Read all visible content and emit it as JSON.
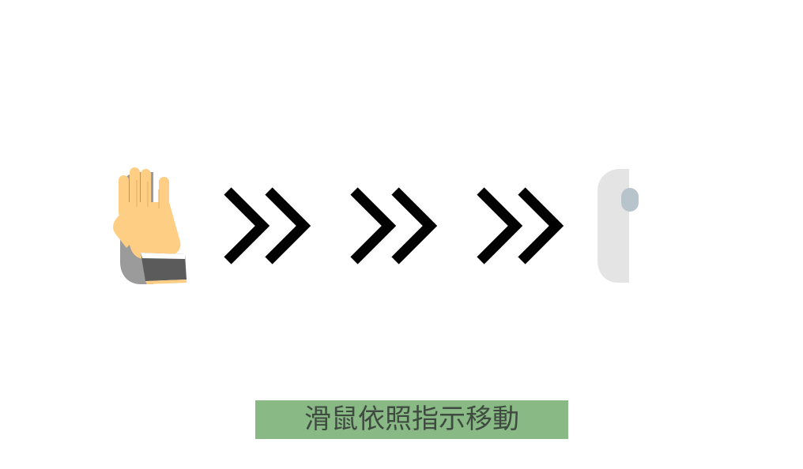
{
  "instruction": {
    "text": "滑鼠依照指示移動"
  },
  "icons": {
    "hand": "hand-on-mouse-icon",
    "arrows": [
      "double-chevron-right-icon",
      "double-chevron-right-icon",
      "double-chevron-right-icon"
    ],
    "target": "mouse-icon"
  },
  "colors": {
    "banner_bg": "#89b985",
    "banner_text": "#3f4a40",
    "chevron": "#000000",
    "skin": "#ffce85",
    "sleeve": "#5b5b5b",
    "mouse_gray": "#9b9b9b",
    "mouse_light": "#e4e4e5",
    "mouse_wheel": "#b8c4cc"
  }
}
